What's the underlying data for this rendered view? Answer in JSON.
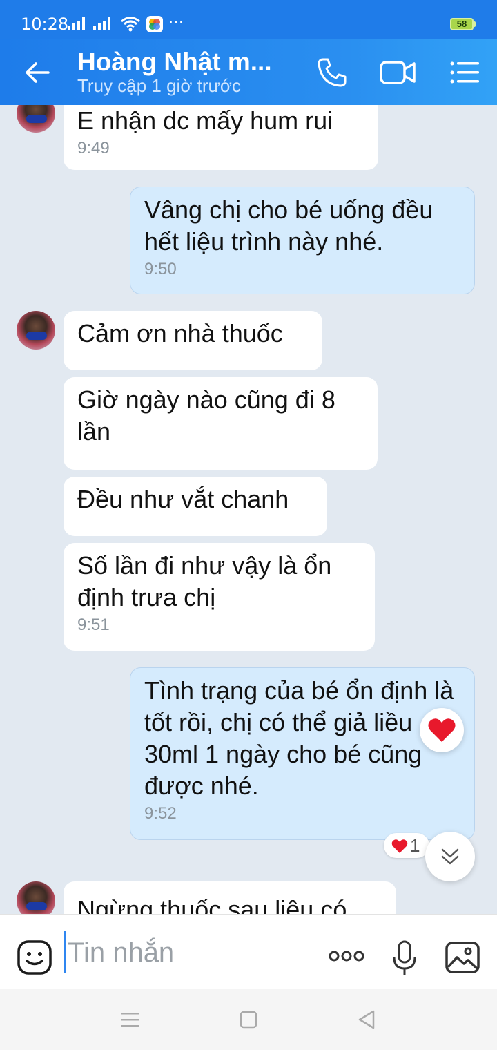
{
  "status_bar": {
    "time": "10:28",
    "battery": "58",
    "overflow": "···",
    "icons": [
      "signal-icon",
      "signal-icon",
      "wifi-icon",
      "app-notification-icon",
      "battery-icon"
    ]
  },
  "header": {
    "contact_name": "Hoàng Nhật m...",
    "last_seen": "Truy cập 1 giờ trước",
    "icons": [
      "back-arrow-icon",
      "phone-call-icon",
      "video-call-icon",
      "menu-list-icon"
    ]
  },
  "messages": [
    {
      "direction": "in",
      "text": "E nhận dc mấy hum rui",
      "time": "9:49"
    },
    {
      "direction": "out",
      "text": "Vâng chị cho bé uống đều hết liệu trình này nhé.",
      "time": "9:50"
    },
    {
      "direction": "in",
      "text": "Cảm ơn nhà thuốc",
      "time": ""
    },
    {
      "direction": "in",
      "text": "Giờ ngày nào cũng đi 8 lần",
      "time": ""
    },
    {
      "direction": "in",
      "text": "Đều như vắt chanh",
      "time": ""
    },
    {
      "direction": "in",
      "text": "Số lần đi như vậy là ổn định trưa chị",
      "time": "9:51"
    },
    {
      "direction": "out",
      "text": "Tình trạng của bé ổn định là tốt rồi, chị có thể giả liều 30ml 1 ngày cho bé cũng được nhé.",
      "time": "9:52"
    },
    {
      "direction": "in",
      "text": "Ngừng thuốc sau liệu có",
      "time": ""
    }
  ],
  "reaction": {
    "icon": "heart-icon",
    "count": "1"
  },
  "input": {
    "placeholder": "Tin nhắn",
    "value": ""
  },
  "colors": {
    "accent": "#1f7ce9",
    "incoming_bubble": "#ffffff",
    "outgoing_bubble": "#d5ebfd",
    "background": "#e2e9f1",
    "heart": "#e8192c"
  }
}
